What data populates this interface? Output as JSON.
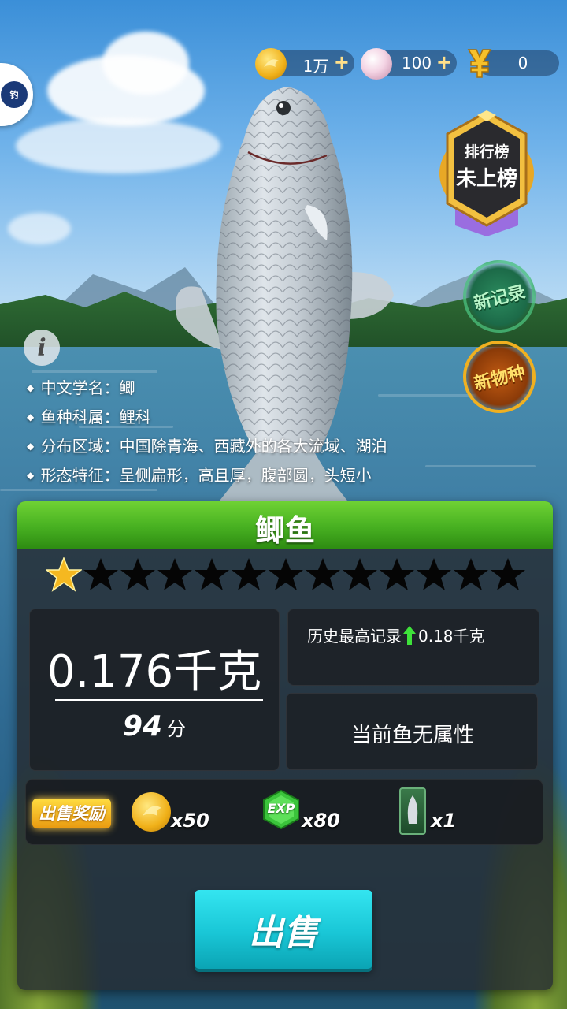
{
  "currencies": [
    {
      "name": "coin-icon",
      "value": "1万"
    },
    {
      "name": "pearl-icon",
      "value": "100"
    },
    {
      "name": "yen-icon",
      "value": "0"
    }
  ],
  "plus_label": "+",
  "ranking": {
    "title": "排行榜",
    "status": "未上榜"
  },
  "stamps": {
    "new_record": "新记录",
    "new_species": "新物种"
  },
  "info_icon": "i",
  "info": [
    {
      "label": "中文学名",
      "value": "鲫"
    },
    {
      "label": "鱼种科属",
      "value": "鲤科"
    },
    {
      "label": "分布区域",
      "value": "中国除青海、西藏外的各大流域、湖泊"
    },
    {
      "label": "形态特征",
      "value": "呈侧扁形，高且厚，腹部圆，头短小"
    }
  ],
  "fish_name": "鲫鱼",
  "stars": {
    "total": 13,
    "filled": 1
  },
  "stats": {
    "weight": "0.176千克",
    "score": "94",
    "score_unit": "分",
    "record_label": "历史最高记录",
    "record_value": "0.18千克",
    "attribute": "当前鱼无属性"
  },
  "rewards": {
    "label": "出售奖励",
    "items": [
      {
        "icon": "coin-icon",
        "qty": "x50"
      },
      {
        "icon": "exp-icon",
        "icon_text": "EXP",
        "qty": "x80"
      },
      {
        "icon": "fish-card-icon",
        "qty": "x1"
      }
    ]
  },
  "sell_label": "出售",
  "colors": {
    "accent_green": "#47b021",
    "sell_cyan": "#19c6d6",
    "gold": "#f5b820"
  }
}
